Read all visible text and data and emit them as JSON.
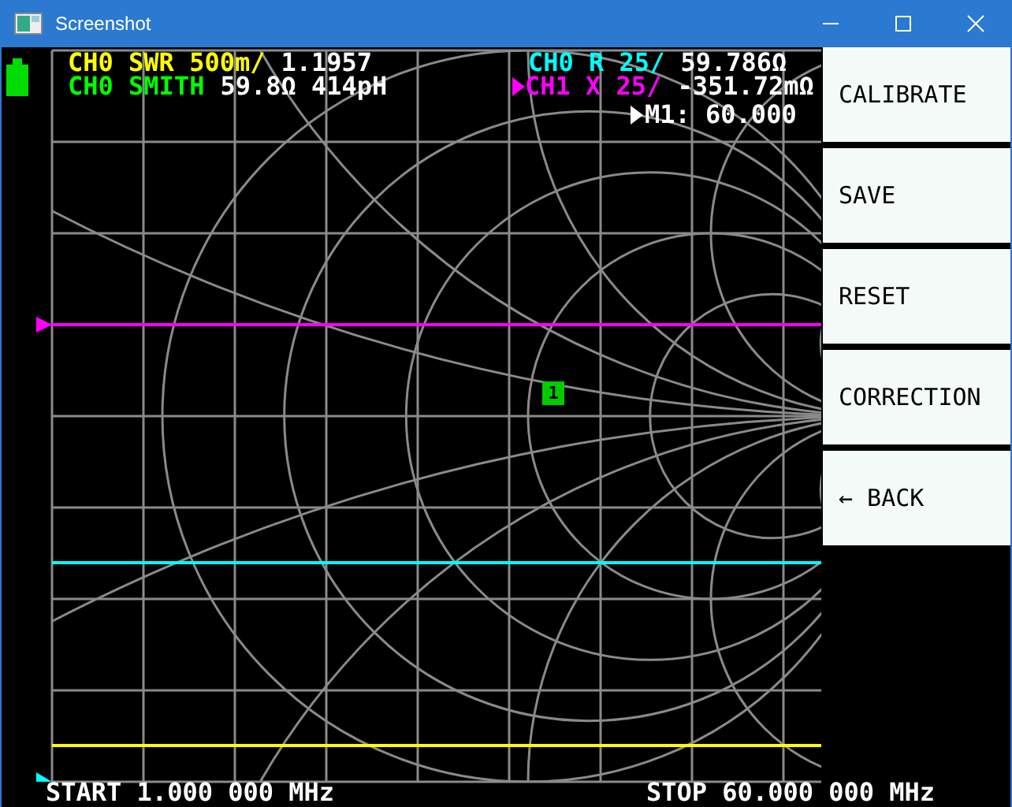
{
  "window": {
    "title": "Screenshot"
  },
  "traces": [
    {
      "label": "CH0 SWR 500m/",
      "value": "1.1957",
      "color": "#ffff00",
      "active": false,
      "kind": "line"
    },
    {
      "label": "CH0 SMITH",
      "value": "59.8Ω 414pH",
      "color": "#00ff00",
      "active": false,
      "kind": "smith"
    },
    {
      "label": "CH0 R 25/",
      "value": "59.786Ω",
      "color": "#00ffff",
      "active": false,
      "kind": "line"
    },
    {
      "label": "CH1 X 25/",
      "value": "-351.72mΩ",
      "color": "#ff00ff",
      "active": true,
      "kind": "line"
    }
  ],
  "marker": {
    "label": "1",
    "readout": "M1: 60.000"
  },
  "menu": [
    {
      "label": "CALIBRATE"
    },
    {
      "label": "SAVE"
    },
    {
      "label": "RESET"
    },
    {
      "label": "CORRECTION"
    },
    {
      "label": "← BACK"
    }
  ],
  "sweep": {
    "start": "START 1.000 000 MHz",
    "stop": "STOP 60.000 000 MHz"
  }
}
